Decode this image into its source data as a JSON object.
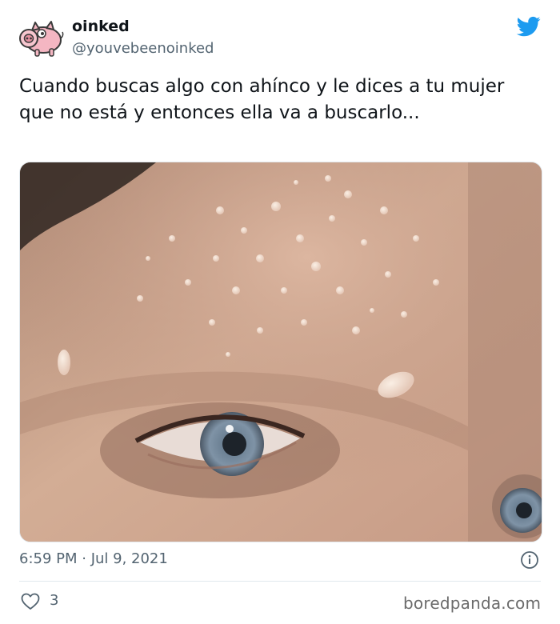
{
  "tweet": {
    "display_name": "oinked",
    "handle": "@youvebeenoinked",
    "text_line1": "Cuando buscas algo con ahínco y le dices a tu mujer",
    "text_line2": "que no está y entonces ella va a buscarlo...",
    "timestamp": "6:59 PM · Jul 9, 2021",
    "like_count": "3",
    "media_description": "close-up photo of a sweaty forehead and blue eye"
  },
  "watermark": "boredpanda.com",
  "icons": {
    "avatar": "pig-avatar-icon",
    "brand": "twitter-bird-icon",
    "info": "info-icon",
    "like": "heart-icon"
  },
  "colors": {
    "twitter_blue": "#1d9bf0",
    "text_primary": "#0f1419",
    "text_secondary": "#536471",
    "divider": "#e1e8ed"
  }
}
